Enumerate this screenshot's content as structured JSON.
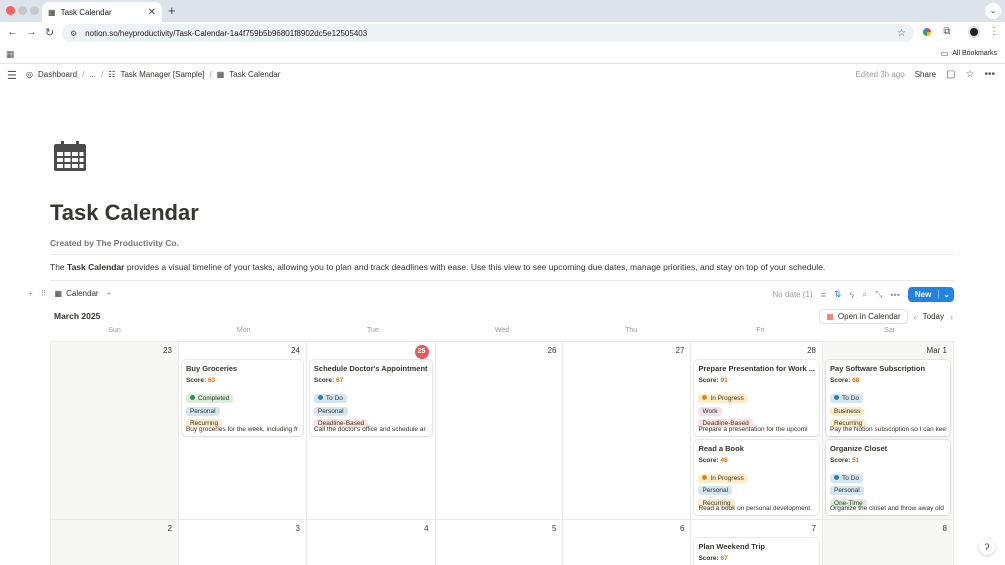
{
  "browser": {
    "tab_title": "Task Calendar",
    "tab_close": "✕",
    "new_tab": "+",
    "url": "notion.so/heyproductivity/Task-Calendar-1a4f759b5b96801f8902dc5e12505403",
    "all_bookmarks": "All Bookmarks"
  },
  "topbar": {
    "breadcrumbs": [
      "Dashboard",
      "...",
      "Task Manager [Sample]",
      "Task Calendar"
    ],
    "separator": "/",
    "edited": "Edited 3h ago",
    "share": "Share"
  },
  "page": {
    "title": "Task Calendar",
    "subtitle": "Created by The Productivity Co.",
    "desc_prefix": "The ",
    "desc_bold": "Task Calendar",
    "desc_rest": " provides a visual timeline of your tasks, allowing you to plan and track deadlines with ease. Use this view to see upcoming due dates, manage priorities, and stay on top of your schedule."
  },
  "database": {
    "view_label": "Calendar",
    "no_date": "No date (1)",
    "new_label": "New",
    "month": "March 2025",
    "open_in_calendar": "Open in Calendar",
    "today": "Today",
    "weekdays": [
      "Sun",
      "Mon",
      "Tue",
      "Wed",
      "Thu",
      "Fri",
      "Sat"
    ]
  },
  "days": {
    "d0": "23",
    "d1": "24",
    "d2": "25",
    "d3": "26",
    "d4": "27",
    "d5": "28",
    "d6": "Mar 1",
    "d7": "2",
    "d8": "3",
    "d9": "4",
    "d10": "5",
    "d11": "6",
    "d12": "7",
    "d13": "8"
  },
  "score_label": "Score: ",
  "cards": {
    "buy_groceries": {
      "title": "Buy Groceries",
      "score": "63",
      "status": "Completed",
      "tag1": "Personal",
      "tag2": "Recurring",
      "desc": "Buy groceries for the week, including fr"
    },
    "doctor": {
      "title": "Schedule Doctor's Appointment",
      "score": "67",
      "status": "To Do",
      "tag1": "Personal",
      "tag2": "Deadline-Based",
      "desc": "Call the doctor's office and schedule ar"
    },
    "presentation": {
      "title": "Prepare Presentation for Work ...",
      "score": "91",
      "status": "In Progress",
      "tag1": "Work",
      "tag2": "Deadline-Based",
      "desc": "Prepare a presentation for the upcomi"
    },
    "read_book": {
      "title": "Read a Book",
      "score": "48",
      "status": "In Progress",
      "tag1": "Personal",
      "tag2": "Recurring",
      "desc": "Read a book on personal development."
    },
    "software": {
      "title": "Pay Software Subscription",
      "score": "68",
      "status": "To Do",
      "tag1": "Business",
      "tag2": "Recurring",
      "desc": "Pay the Notion subscription so I can kee"
    },
    "closet": {
      "title": "Organize Closet",
      "score": "51",
      "status": "To Do",
      "tag1": "Personal",
      "tag2": "One-Time",
      "desc": "Organize the closet and throw away old"
    },
    "weekend": {
      "title": "Plan Weekend Trip",
      "score": "67"
    }
  },
  "colors": {
    "accent": "#2383e2",
    "today_badge": "#eb5757",
    "score": "#d9730d",
    "completed_bg": "#dbeddb",
    "completed_dot": "#448361",
    "todo_bg": "#d3e5ef",
    "todo_dot": "#337ea9",
    "inprogress_bg": "#fdecc8",
    "inprogress_dot": "#cb912f",
    "personal_bg": "#d3e5ef",
    "recurring_bg": "#fdecc8",
    "deadline_bg": "#ffe2dd",
    "work_bg": "#f4dfeb",
    "business_bg": "#fdecc8",
    "onetime_bg": "#dbeddb"
  },
  "icons": {
    "page_icon": "calendar-icon",
    "view_icon": "calendar-icon"
  }
}
